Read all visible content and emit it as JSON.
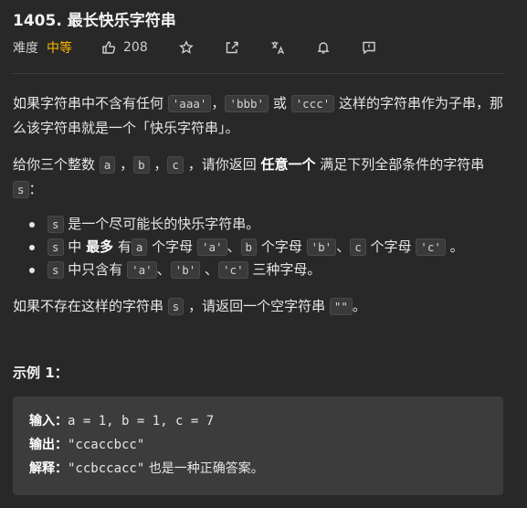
{
  "header": {
    "title": "1405. 最长快乐字符串",
    "difficulty_label": "难度",
    "difficulty": "中等",
    "likes": "208",
    "icons": [
      "thumbs-up-icon",
      "star-icon",
      "share-icon",
      "translate-icon",
      "bell-icon",
      "feedback-icon"
    ]
  },
  "colors": {
    "difficulty": "#ffb800",
    "background": "#282828",
    "code_bg": "#3a3a3a"
  },
  "p1": {
    "t1": "如果字符串中不含有任何 ",
    "c1": "'aaa'",
    "t2": "，",
    "c2": "'bbb'",
    "t3": " 或 ",
    "c3": "'ccc'",
    "t4": " 这样的字符串作为子串，那么该字符串就是一个「快乐字符串」。"
  },
  "p2": {
    "t1": "给你三个整数 ",
    "c1": "a",
    "t2": " ，",
    "c2": "b",
    "t3": " ，",
    "c3": "c",
    "t4": " ，请你返回 ",
    "b1": "任意一个",
    "t5": " 满足下列全部条件的字符串 ",
    "c4": "s",
    "t6": "："
  },
  "list": {
    "i1": {
      "c1": "s",
      "t1": " 是一个尽可能长的快乐字符串。"
    },
    "i2": {
      "c1": "s",
      "t1": " 中 ",
      "b1": "最多",
      "t2": " 有",
      "c2": "a",
      "t3": " 个字母 ",
      "c3": "'a'",
      "t4": "、",
      "c4": "b",
      "t5": " 个字母 ",
      "c5": "'b'",
      "t6": "、",
      "c6": "c",
      "t7": " 个字母 ",
      "c7": "'c'",
      "t8": " 。"
    },
    "i3": {
      "c1": "s",
      "t1": " 中只含有 ",
      "c2": "'a'",
      "t2": "、",
      "c3": "'b'",
      "t3": " 、",
      "c4": "'c'",
      "t4": " 三种字母。"
    }
  },
  "p3": {
    "t1": "如果不存在这样的字符串 ",
    "c1": "s",
    "t2": " ，请返回一个空字符串 ",
    "c2": "\"\"",
    "t3": "。"
  },
  "example": {
    "title": "示例 1：",
    "input_label": "输入：",
    "input_value": "a = 1, b = 1, c = 7",
    "output_label": "输出：",
    "output_value": "\"ccaccbcc\"",
    "explain_label": "解释：",
    "explain_value": "\"ccbccacc\"",
    "explain_text": " 也是一种正确答案。"
  }
}
